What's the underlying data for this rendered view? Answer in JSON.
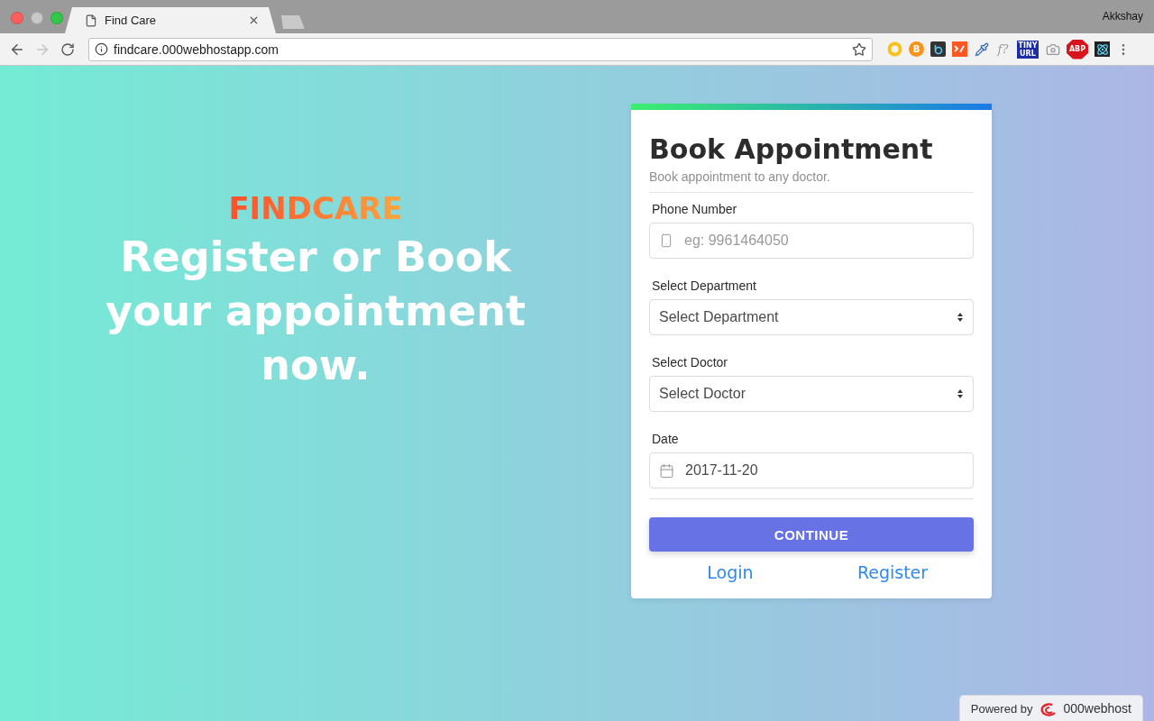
{
  "browser": {
    "tabs": [
      {
        "title": "Find Care",
        "selected": true
      }
    ],
    "profile": "Akkshay",
    "address": "findcare.000webhostapp.com",
    "extensions": [
      {
        "kind": "ring"
      },
      {
        "kind": "badge",
        "glyph": "B"
      },
      {
        "kind": "dark"
      },
      {
        "kind": "code"
      },
      {
        "kind": "dropper"
      },
      {
        "kind": "formula",
        "glyph": "f?"
      },
      {
        "kind": "tinyurl",
        "glyph": "TINY",
        "glyph2": "URL"
      },
      {
        "kind": "camera"
      },
      {
        "kind": "abp",
        "glyph": "ABP"
      },
      {
        "kind": "atom"
      }
    ]
  },
  "hero": {
    "brand": "FINDCARE",
    "heading": "Register or Book your appointment now."
  },
  "card": {
    "title": "Book Appointment",
    "subtitle": "Book appointment to any doctor.",
    "fields": [
      {
        "kind": "phone",
        "label": "Phone Number",
        "placeholder": "eg: 9961464050"
      },
      {
        "kind": "select",
        "label": "Select Department",
        "value": "Select Department"
      },
      {
        "kind": "select",
        "label": "Select Doctor",
        "value": "Select Doctor"
      },
      {
        "kind": "date",
        "label": "Date",
        "value": "2017-11-20"
      }
    ],
    "button": "CONTINUE",
    "links": [
      "Login",
      "Register"
    ]
  },
  "footer_badge": {
    "prefix": "Powered by",
    "brand": "000webhost"
  }
}
